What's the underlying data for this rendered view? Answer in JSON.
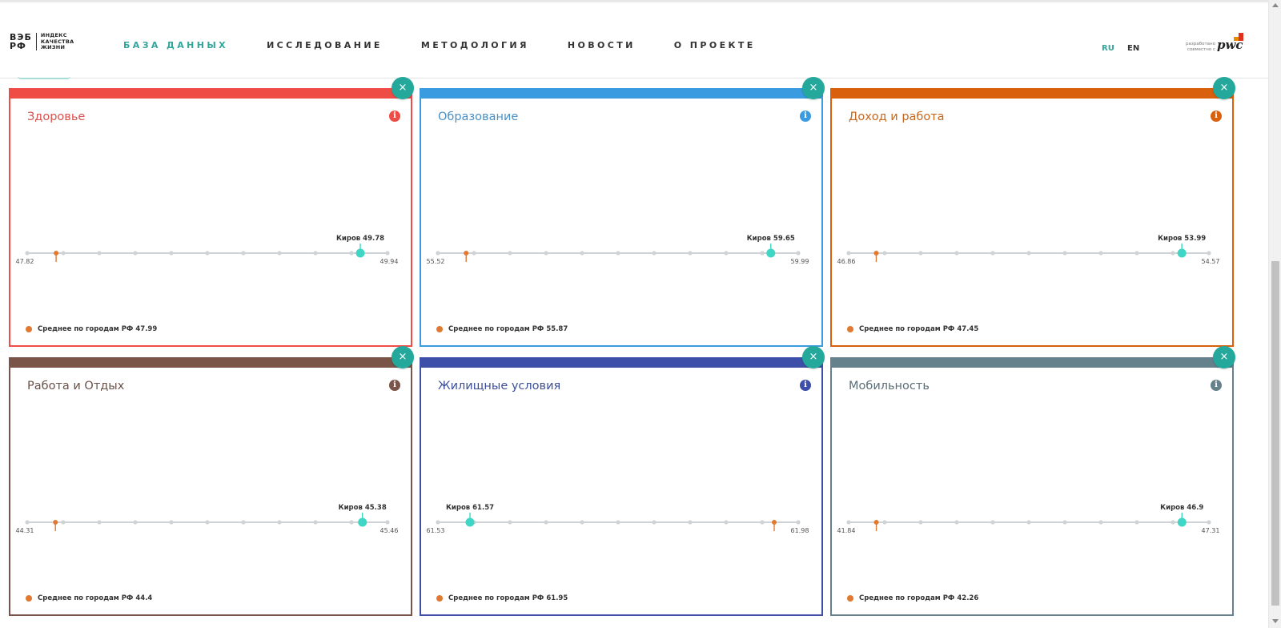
{
  "header": {
    "logo": {
      "mark_top": "ВЭБ",
      "mark_bottom": "РФ",
      "line1": "ИНДЕКС",
      "line2": "КАЧЕСТВА",
      "line3": "ЖИЗНИ"
    },
    "nav": [
      {
        "label": "БАЗА ДАННЫХ",
        "active": true
      },
      {
        "label": "ИССЛЕДОВАНИЕ",
        "active": false
      },
      {
        "label": "МЕТОДОЛОГИЯ",
        "active": false
      },
      {
        "label": "НОВОСТИ",
        "active": false
      },
      {
        "label": "О ПРОЕКТЕ",
        "active": false
      }
    ],
    "lang_ru": "RU",
    "lang_en": "EN",
    "partner_caption_1": "разработано",
    "partner_caption_2": "совместно с",
    "partner_logo": "pwc"
  },
  "legend_label": "Среднее по городам РФ",
  "city_name": "Киров",
  "close_glyph": "×",
  "info_glyph": "i",
  "colors": {
    "accent": "#25a89c",
    "city_marker": "#3fd6c6",
    "average_marker": "#e07a32",
    "track": "#cfd3d6"
  },
  "cards": [
    {
      "title": "Здоровье",
      "color": "#ef4c46",
      "title_color": "#d9524d",
      "min": "47.82",
      "max": "49.94",
      "city": "49.78",
      "avg": "47.99",
      "min_v": 47.82,
      "max_v": 49.94,
      "city_v": 49.78,
      "avg_v": 47.99
    },
    {
      "title": "Образование",
      "color": "#3a9be0",
      "title_color": "#4a90c4",
      "min": "55.52",
      "max": "59.99",
      "city": "59.65",
      "avg": "55.87",
      "min_v": 55.52,
      "max_v": 59.99,
      "city_v": 59.65,
      "avg_v": 55.87
    },
    {
      "title": "Доход и работа",
      "color": "#d9600c",
      "title_color": "#c8661e",
      "min": "46.86",
      "max": "54.57",
      "city": "53.99",
      "avg": "47.45",
      "min_v": 46.86,
      "max_v": 54.57,
      "city_v": 53.99,
      "avg_v": 47.45
    },
    {
      "title": "Работа и Отдых",
      "color": "#7a5448",
      "title_color": "#6a5048",
      "min": "44.31",
      "max": "45.46",
      "city": "45.38",
      "avg": "44.4",
      "min_v": 44.31,
      "max_v": 45.46,
      "city_v": 45.38,
      "avg_v": 44.4
    },
    {
      "title": "Жилищные условия",
      "color": "#3d4fa8",
      "title_color": "#3d4f98",
      "min": "61.53",
      "max": "61.98",
      "city": "61.57",
      "avg": "61.95",
      "min_v": 61.53,
      "max_v": 61.98,
      "city_v": 61.57,
      "avg_v": 61.95
    },
    {
      "title": "Мобильность",
      "color": "#66808c",
      "title_color": "#5d6e78",
      "min": "41.84",
      "max": "47.31",
      "city": "46.9",
      "avg": "42.26",
      "min_v": 41.84,
      "max_v": 47.31,
      "city_v": 46.9,
      "avg_v": 42.26
    }
  ]
}
